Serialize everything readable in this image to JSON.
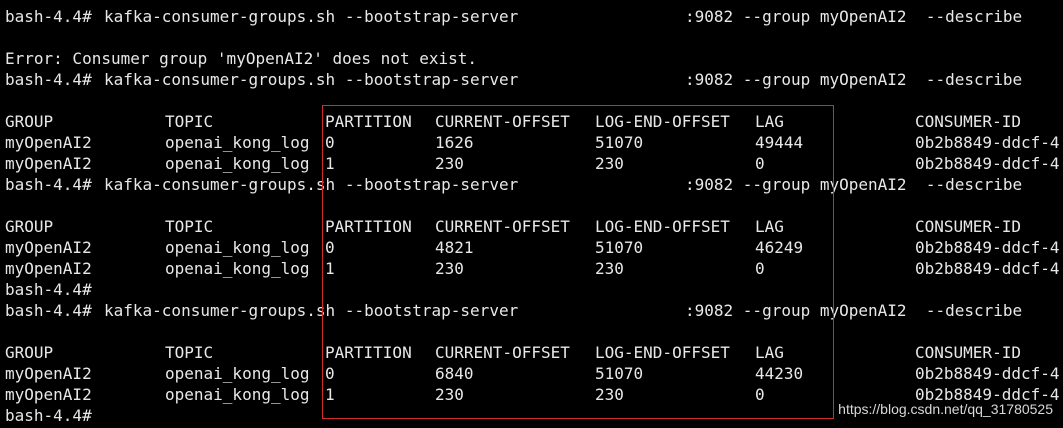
{
  "terminal": {
    "theme": {
      "background": "#000000",
      "foreground": "#e8e8e8",
      "box_color": "#d02a2a"
    },
    "lines": [
      {
        "kind": "cmd",
        "prompt": "bash-4.4#",
        "cmd_a": "kafka-consumer-groups.sh --bootstrap-server",
        "cmd_b": ":9082 --group myOpenAI2  --describe"
      },
      {
        "kind": "blank"
      },
      {
        "kind": "text",
        "text": "Error: Consumer group 'myOpenAI2' does not exist."
      },
      {
        "kind": "cmd",
        "prompt": "bash-4.4#",
        "cmd_a": "kafka-consumer-groups.sh --bootstrap-server",
        "cmd_b": ":9082 --group myOpenAI2  --describe"
      },
      {
        "kind": "blank"
      },
      {
        "kind": "row",
        "cells": [
          "GROUP",
          "TOPIC",
          "PARTITION",
          "CURRENT-OFFSET",
          "LOG-END-OFFSET",
          "LAG",
          "CONSUMER-ID"
        ]
      },
      {
        "kind": "row",
        "cells": [
          "myOpenAI2",
          "openai_kong_log",
          "0",
          "1626",
          "51070",
          "49444",
          "0b2b8849-ddcf-4"
        ]
      },
      {
        "kind": "row",
        "cells": [
          "myOpenAI2",
          "openai_kong_log",
          "1",
          "230",
          "230",
          "0",
          "0b2b8849-ddcf-4"
        ]
      },
      {
        "kind": "cmd",
        "prompt": "bash-4.4#",
        "cmd_a": "kafka-consumer-groups.sh --bootstrap-server",
        "cmd_b": ":9082 --group myOpenAI2  --describe"
      },
      {
        "kind": "blank"
      },
      {
        "kind": "row",
        "cells": [
          "GROUP",
          "TOPIC",
          "PARTITION",
          "CURRENT-OFFSET",
          "LOG-END-OFFSET",
          "LAG",
          "CONSUMER-ID"
        ]
      },
      {
        "kind": "row",
        "cells": [
          "myOpenAI2",
          "openai_kong_log",
          "0",
          "4821",
          "51070",
          "46249",
          "0b2b8849-ddcf-4"
        ]
      },
      {
        "kind": "row",
        "cells": [
          "myOpenAI2",
          "openai_kong_log",
          "1",
          "230",
          "230",
          "0",
          "0b2b8849-ddcf-4"
        ]
      },
      {
        "kind": "text",
        "text": "bash-4.4#"
      },
      {
        "kind": "cmd",
        "prompt": "bash-4.4#",
        "cmd_a": "kafka-consumer-groups.sh --bootstrap-server",
        "cmd_b": ":9082 --group myOpenAI2  --describe"
      },
      {
        "kind": "blank"
      },
      {
        "kind": "row",
        "cells": [
          "GROUP",
          "TOPIC",
          "PARTITION",
          "CURRENT-OFFSET",
          "LOG-END-OFFSET",
          "LAG",
          "CONSUMER-ID"
        ]
      },
      {
        "kind": "row",
        "cells": [
          "myOpenAI2",
          "openai_kong_log",
          "0",
          "6840",
          "51070",
          "44230",
          "0b2b8849-ddcf-4"
        ]
      },
      {
        "kind": "row",
        "cells": [
          "myOpenAI2",
          "openai_kong_log",
          "1",
          "230",
          "230",
          "0",
          "0b2b8849-ddcf-4"
        ]
      },
      {
        "kind": "text",
        "text": "bash-4.4#"
      }
    ]
  },
  "watermark": "https://blog.csdn.net/qq_31780525"
}
